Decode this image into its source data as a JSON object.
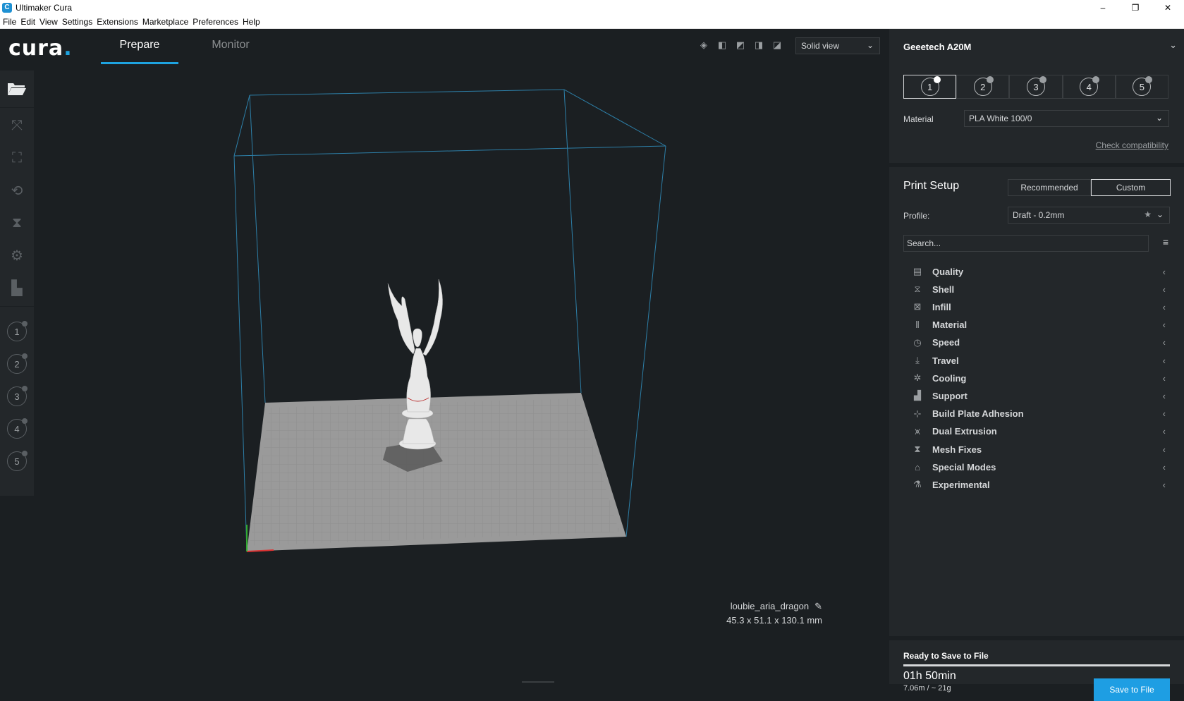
{
  "window": {
    "title": "Ultimaker Cura",
    "app_icon": "cura-icon",
    "controls": [
      "–",
      "❐",
      "✕"
    ]
  },
  "menu": [
    "File",
    "Edit",
    "View",
    "Settings",
    "Extensions",
    "Marketplace",
    "Preferences",
    "Help"
  ],
  "header": {
    "logo_text": "cura",
    "logo_dot": ".",
    "tabs": [
      "Prepare",
      "Monitor"
    ],
    "view_select": "Solid view"
  },
  "printer": {
    "name": "Geeetech A20M",
    "extruders": [
      "1",
      "2",
      "3",
      "4",
      "5"
    ],
    "material_label": "Material",
    "material_value": "PLA White 100/0",
    "check_compatibility": "Check compatibility"
  },
  "print_setup": {
    "title": "Print Setup",
    "mode_recommended": "Recommended",
    "mode_custom": "Custom",
    "profile_label": "Profile:",
    "profile_value": "Draft - 0.2mm",
    "search_placeholder": "Search...",
    "categories": [
      {
        "label": "Quality",
        "icon": "quality-icon"
      },
      {
        "label": "Shell",
        "icon": "shell-icon"
      },
      {
        "label": "Infill",
        "icon": "infill-icon"
      },
      {
        "label": "Material",
        "icon": "material-icon"
      },
      {
        "label": "Speed",
        "icon": "speed-icon"
      },
      {
        "label": "Travel",
        "icon": "travel-icon"
      },
      {
        "label": "Cooling",
        "icon": "cooling-icon"
      },
      {
        "label": "Support",
        "icon": "support-icon"
      },
      {
        "label": "Build Plate Adhesion",
        "icon": "adhesion-icon"
      },
      {
        "label": "Dual Extrusion",
        "icon": "dual-extrusion-icon"
      },
      {
        "label": "Mesh Fixes",
        "icon": "mesh-fixes-icon"
      },
      {
        "label": "Special Modes",
        "icon": "special-modes-icon"
      },
      {
        "label": "Experimental",
        "icon": "experimental-icon"
      }
    ]
  },
  "model": {
    "name": "loubie_aria_dragon",
    "dimensions": "45.3 x 51.1 x 130.1 mm"
  },
  "output": {
    "status": "Ready to Save to File",
    "progress": 1.0,
    "print_time": "01h 50min",
    "usage": "7.06m / ~ 21g",
    "save_button": "Save to File"
  },
  "left_toolbar": {
    "extruder_numbers": [
      "1",
      "2",
      "3",
      "4",
      "5"
    ]
  },
  "colors": {
    "accent": "#1ea3e0",
    "background": "#1b1f22",
    "panel": "#23272a",
    "build_volume_edge": "#2d7fa8",
    "build_plate": "#9a9a9a"
  }
}
